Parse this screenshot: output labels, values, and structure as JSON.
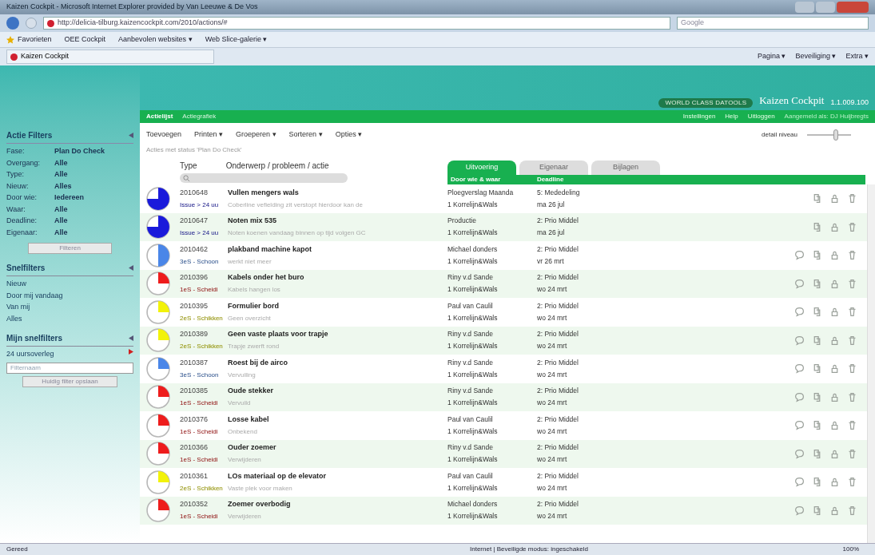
{
  "browser": {
    "title": "Kaizen Cockpit - Microsoft Internet Explorer provided by Van Leeuwe & De Vos",
    "address": "http://delicia-tilburg.kaizencockpit.com/2010/actions/#",
    "search_placeholder": "Google",
    "favorites": [
      "Favorieten",
      "OEE Cockpit",
      "Aanbevolen websites ▾",
      "Web Slice-galerie ▾"
    ],
    "tab": "Kaizen Cockpit",
    "commands": [
      "Pagina ▾",
      "Beveiliging ▾",
      "Extra ▾"
    ]
  },
  "header": {
    "brand": "WORLD CLASS DATOOLS",
    "product": "Kaizen Cockpit",
    "version": "1.1.009.100"
  },
  "nav": {
    "items": [
      {
        "label": "Actielijst",
        "selected": true
      },
      {
        "label": "Actiegrafiek",
        "selected": false
      }
    ],
    "links": [
      "Instellingen",
      "Help",
      "Uitloggen"
    ],
    "user": "Aangemeld als: DJ Huijbregts"
  },
  "sidebar": {
    "title": "Actie Filters",
    "filters": [
      {
        "label": "Fase:",
        "value": "Plan Do Check"
      },
      {
        "label": "Overgang:",
        "value": "Alle"
      },
      {
        "label": "Type:",
        "value": "Alle"
      },
      {
        "label": "Nieuw:",
        "value": "Alles"
      },
      {
        "label": "Door wie:",
        "value": "Iedereen"
      },
      {
        "label": "Waar:",
        "value": "Alle"
      },
      {
        "label": "Deadline:",
        "value": "Alle"
      },
      {
        "label": "Eigenaar:",
        "value": "Alle"
      }
    ],
    "filter_button": "Filteren",
    "quick_title": "Snelfilters",
    "quick": [
      "Nieuw",
      "Door mij vandaag",
      "Van mij",
      "Alles"
    ],
    "my_title": "Mijn snelfilters",
    "my": [
      {
        "label": "24 uursoverleg"
      }
    ],
    "name_placeholder": "Filternaam",
    "save_button": "Huidig filter opslaan"
  },
  "toolbar": [
    "Toevoegen",
    "Printen ▾",
    "Groeperen ▾",
    "Sorteren ▾",
    "Opties ▾"
  ],
  "detail": {
    "label": "detail niveau",
    "level": 0.6
  },
  "status_text": "Acties met status 'Plan Do Check'",
  "columns": {
    "type": "Type",
    "subject": "Onderwerp / probleem / actie",
    "who": "Door wie & waar",
    "deadline": "Deadline"
  },
  "tabs": [
    {
      "label": "Uitvoering",
      "selected": true
    },
    {
      "label": "Eigenaar",
      "selected": false
    },
    {
      "label": "Bijlagen",
      "selected": false
    }
  ],
  "rows": [
    {
      "id": "2010648",
      "title": "Vullen mengers wals",
      "category": "Issue > 24 uu",
      "color": "#1a1adb",
      "kind": "three_quarters",
      "description": "Coberline vefielding zit verstopt hierdoor kan de",
      "who": "Ploegverslag Maanda",
      "where": "1 Korrelijn&Wals",
      "priority": "5: Mededeling",
      "deadline": "ma 26 jul",
      "comment": false
    },
    {
      "id": "2010647",
      "title": "Noten mix 535",
      "category": "Issue > 24 uu",
      "color": "#1a1adb",
      "kind": "three_quarters",
      "description": "Noten koenen vandaag binnen op tijd volgen GC",
      "who": "Productie",
      "where": "1 Korrelijn&Wals",
      "priority": "2: Prio Middel",
      "deadline": "ma 26 jul",
      "comment": false
    },
    {
      "id": "2010462",
      "title": "plakband machine kapot",
      "category": "3eS - Schoon",
      "color": "#4a86e8",
      "kind": "half",
      "description": "werkt niet meer",
      "who": "Michael donders",
      "where": "1 Korrelijn&Wals",
      "priority": "2: Prio Middel",
      "deadline": "vr 26 mrt",
      "comment": true
    },
    {
      "id": "2010396",
      "title": "Kabels onder het buro",
      "category": "1eS - Scheidi",
      "color": "#ee1c1c",
      "kind": "quarter",
      "description": "Kabels hangen los",
      "who": "Riny v.d Sande",
      "where": "1 Korrelijn&Wals",
      "priority": "2: Prio Middel",
      "deadline": "wo 24 mrt",
      "comment": true
    },
    {
      "id": "2010395",
      "title": "Formulier bord",
      "category": "2eS - Schikken",
      "color": "#f2f20a",
      "kind": "quarter",
      "description": "Geen overzicht",
      "who": "Paul van Caulil",
      "where": "1 Korrelijn&Wals",
      "priority": "2: Prio Middel",
      "deadline": "wo 24 mrt",
      "comment": true
    },
    {
      "id": "2010389",
      "title": "Geen vaste plaats voor trapje",
      "category": "2eS - Schikken",
      "color": "#f2f20a",
      "kind": "quarter",
      "description": "Trapje zwerft rond",
      "who": "Riny v.d Sande",
      "where": "1 Korrelijn&Wals",
      "priority": "2: Prio Middel",
      "deadline": "wo 24 mrt",
      "comment": true
    },
    {
      "id": "2010387",
      "title": "Roest bij de airco",
      "category": "3eS - Schoon",
      "color": "#4a86e8",
      "kind": "quarter",
      "description": "Vervuiling",
      "who": "Riny v.d Sande",
      "where": "1 Korrelijn&Wals",
      "priority": "2: Prio Middel",
      "deadline": "wo 24 mrt",
      "comment": true
    },
    {
      "id": "2010385",
      "title": "Oude stekker",
      "category": "1eS - Scheidi",
      "color": "#ee1c1c",
      "kind": "quarter",
      "description": "Vervuild",
      "who": "Riny v.d Sande",
      "where": "1 Korrelijn&Wals",
      "priority": "2: Prio Middel",
      "deadline": "wo 24 mrt",
      "comment": true
    },
    {
      "id": "2010376",
      "title": "Losse kabel",
      "category": "1eS - Scheidi",
      "color": "#ee1c1c",
      "kind": "quarter",
      "description": "Onbekend",
      "who": "Paul van Caulil",
      "where": "1 Korrelijn&Wals",
      "priority": "2: Prio Middel",
      "deadline": "wo 24 mrt",
      "comment": true
    },
    {
      "id": "2010366",
      "title": "Ouder zoemer",
      "category": "1eS - Scheidi",
      "color": "#ee1c1c",
      "kind": "quarter",
      "description": "Verwijderen",
      "who": "Riny v.d Sande",
      "where": "1 Korrelijn&Wals",
      "priority": "2: Prio Middel",
      "deadline": "wo 24 mrt",
      "comment": true
    },
    {
      "id": "2010361",
      "title": "LOs materiaal op de elevator",
      "category": "2eS - Schikken",
      "color": "#f2f20a",
      "kind": "quarter",
      "description": "Vaste plek voor maken",
      "who": "Paul van Caulil",
      "where": "1 Korrelijn&Wals",
      "priority": "2: Prio Middel",
      "deadline": "wo 24 mrt",
      "comment": true
    },
    {
      "id": "2010352",
      "title": "Zoemer overbodig",
      "category": "1eS - Scheidi",
      "color": "#ee1c1c",
      "kind": "quarter",
      "description": "Verwijderen",
      "who": "Michael donders",
      "where": "1 Korrelijn&Wals",
      "priority": "2: Prio Middel",
      "deadline": "wo 24 mrt",
      "comment": true
    }
  ],
  "status_bar": {
    "left": "Gereed",
    "zone": "Internet | Beveiligde modus: ingeschakeld",
    "zoom": "100%"
  }
}
